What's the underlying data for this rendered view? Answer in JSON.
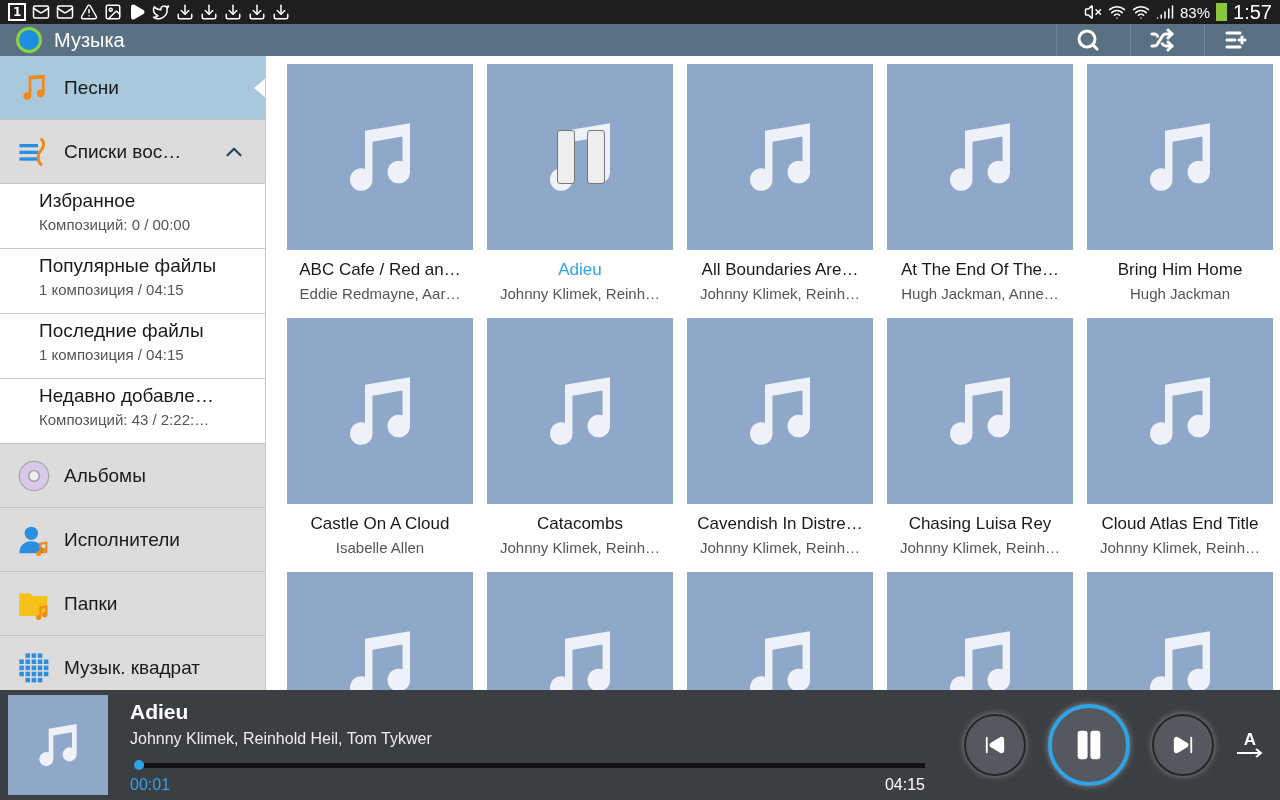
{
  "status_bar": {
    "notification_count": "1",
    "battery": "83%",
    "time": "1:57"
  },
  "app_bar": {
    "title": "Музыка"
  },
  "sidebar": {
    "items": [
      {
        "kind": "nav",
        "label": "Песни",
        "selected": true
      },
      {
        "kind": "group",
        "label": "Списки вос…",
        "expanded": true,
        "children": [
          {
            "title": "Избранное",
            "subtitle": "Композиций: 0 / 00:00"
          },
          {
            "title": "Популярные файлы",
            "subtitle": "1 композиция / 04:15"
          },
          {
            "title": "Последние файлы",
            "subtitle": "1 композиция / 04:15"
          },
          {
            "title": "Недавно добавле…",
            "subtitle": "Композиций: 43 / 2:22:…"
          }
        ]
      },
      {
        "kind": "nav",
        "label": "Альбомы",
        "selected": false
      },
      {
        "kind": "nav",
        "label": "Исполнители",
        "selected": false
      },
      {
        "kind": "nav",
        "label": "Папки",
        "selected": false
      },
      {
        "kind": "nav",
        "label": "Музык. квадрат",
        "selected": false
      }
    ]
  },
  "songs": [
    {
      "title": "ABC Cafe / Red an…",
      "artist": "Eddie Redmayne, Aar…",
      "playing": false
    },
    {
      "title": "Adieu",
      "artist": "Johnny Klimek, Reinh…",
      "playing": true
    },
    {
      "title": "All Boundaries Are…",
      "artist": "Johnny Klimek, Reinh…",
      "playing": false
    },
    {
      "title": "At The End Of The…",
      "artist": "Hugh Jackman, Anne…",
      "playing": false
    },
    {
      "title": "Bring Him Home",
      "artist": "Hugh Jackman",
      "playing": false
    },
    {
      "title": "Castle On A Cloud",
      "artist": "Isabelle Allen",
      "playing": false
    },
    {
      "title": "Catacombs",
      "artist": "Johnny Klimek, Reinh…",
      "playing": false
    },
    {
      "title": "Cavendish In Distre…",
      "artist": "Johnny Klimek, Reinh…",
      "playing": false
    },
    {
      "title": "Chasing Luisa Rey",
      "artist": "Johnny Klimek, Reinh…",
      "playing": false
    },
    {
      "title": "Cloud Atlas End Title",
      "artist": "Johnny Klimek, Reinh…",
      "playing": false
    },
    {
      "playing": false
    },
    {
      "playing": false
    },
    {
      "playing": false
    },
    {
      "playing": false
    },
    {
      "playing": false
    }
  ],
  "player": {
    "title": "Adieu",
    "artist": "Johnny Klimek, Reinhold Heil, Tom Tykwer",
    "elapsed": "00:01",
    "total": "04:15",
    "level": 0.005,
    "playing": true,
    "lyrics_label": "A"
  }
}
